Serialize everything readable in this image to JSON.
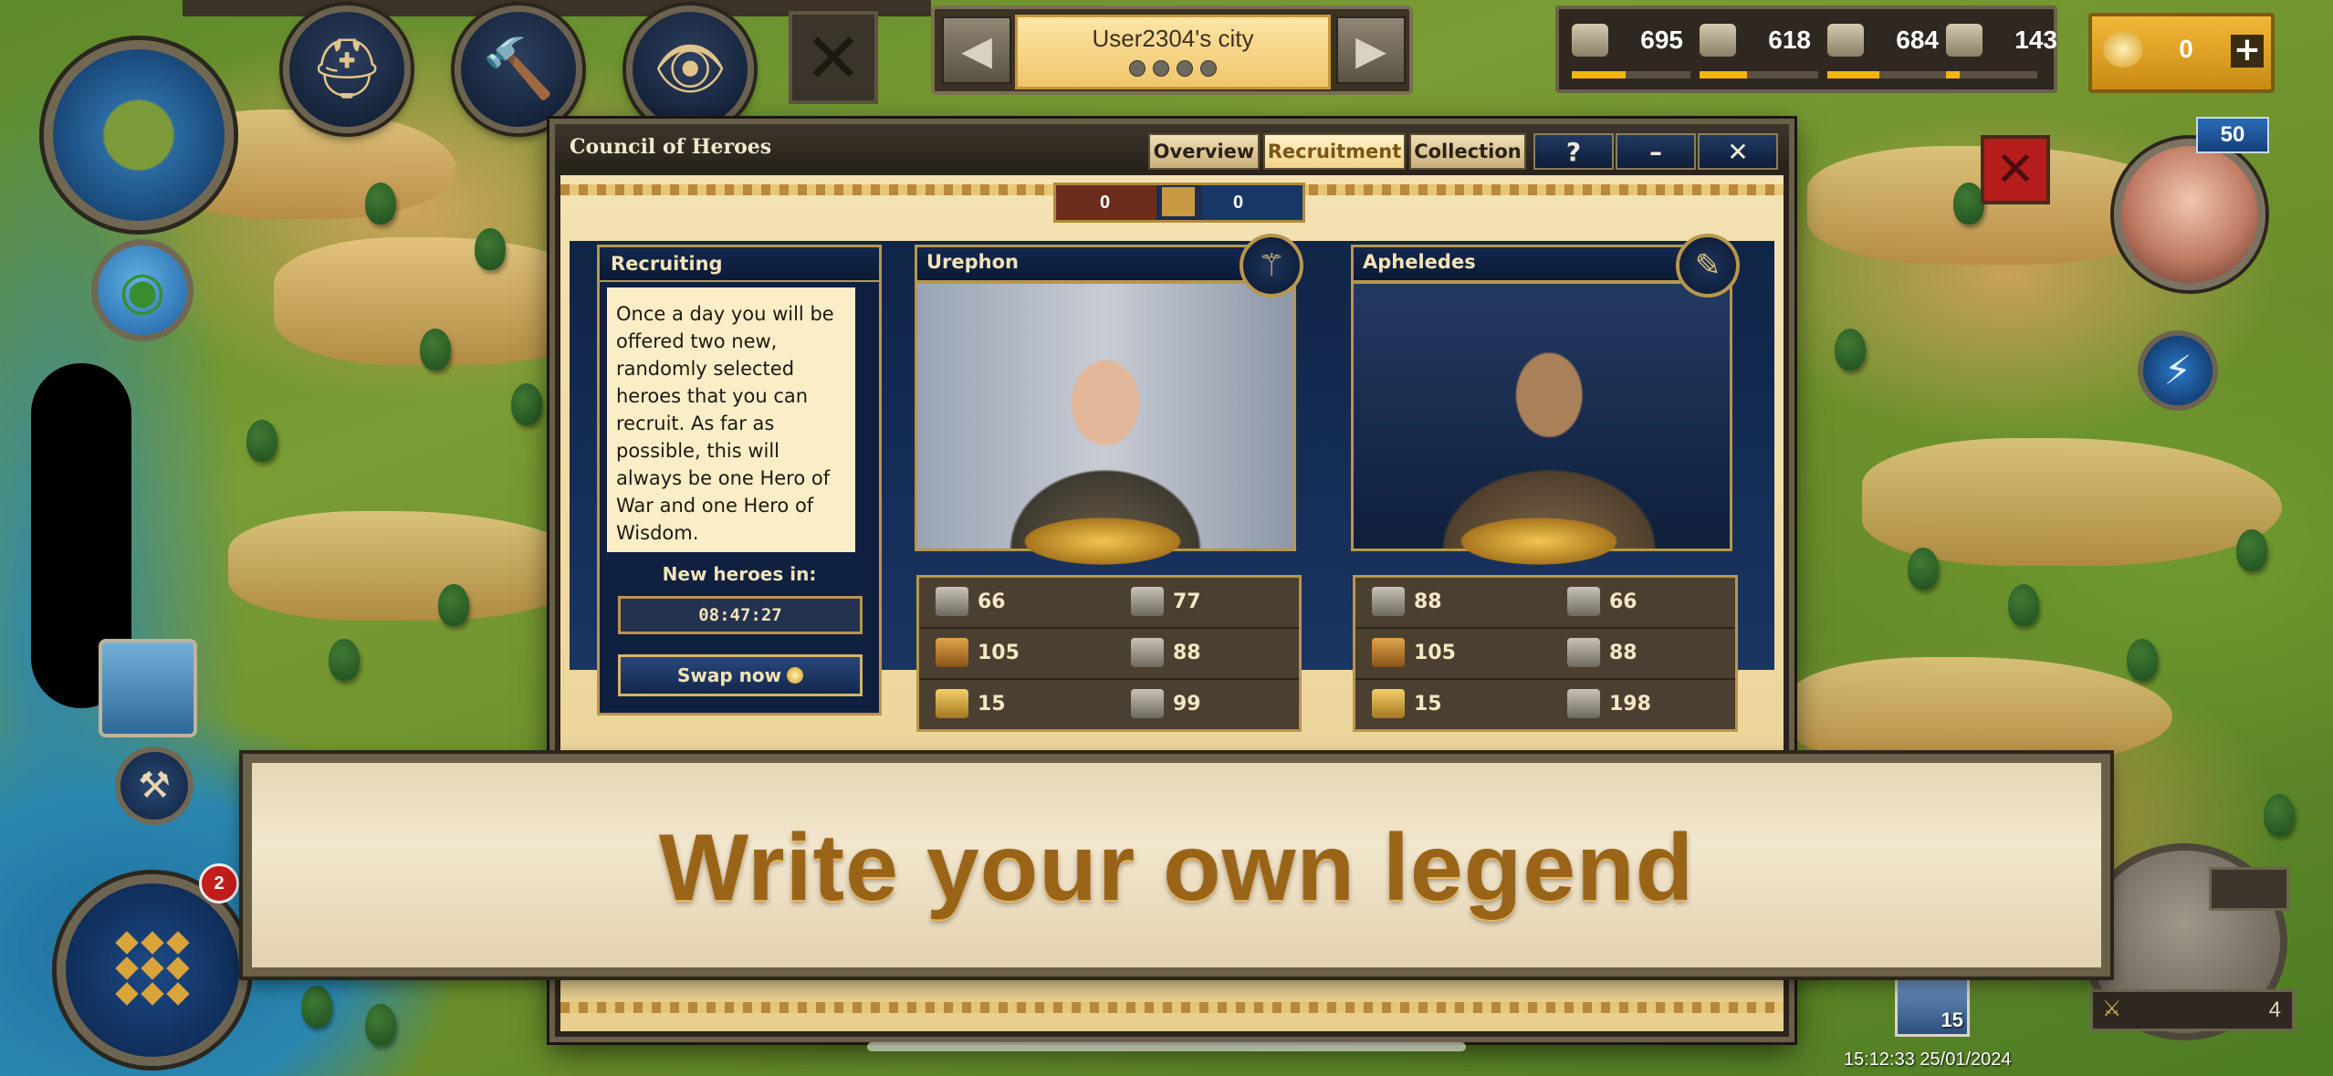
{
  "city": {
    "name": "User2304's city"
  },
  "resources": {
    "wood": "695",
    "stone": "618",
    "silver": "684",
    "population": "143",
    "gold": "0"
  },
  "player": {
    "level": "50"
  },
  "dialog": {
    "title": "Council of Heroes",
    "tabs": [
      {
        "label": "Overview"
      },
      {
        "label": "Recruitment"
      },
      {
        "label": "Collection"
      }
    ],
    "controls": {
      "help": "?",
      "minimize": "–",
      "close": "✕"
    },
    "hero_counts": {
      "war": "0",
      "wisdom": "0"
    },
    "recruiting": {
      "heading": "Recruiting",
      "description": "Once a day you will be offered two new, randomly selected heroes that you can recruit. As far as possible, this will always be one Hero of War and one Hero of Wisdom.",
      "new_heroes_label": "New heroes in:",
      "timer": "08:47:27",
      "swap_label": "Swap now"
    },
    "heroes": [
      {
        "name": "Urephon",
        "stats": [
          "66",
          "77",
          "105",
          "88",
          "15",
          "99"
        ]
      },
      {
        "name": "Apheledes",
        "stats": [
          "88",
          "66",
          "105",
          "88",
          "15",
          "198"
        ]
      }
    ]
  },
  "banner": {
    "text": "Write your own legend"
  },
  "notifications": {
    "menu_badge": "2"
  },
  "units": {
    "count": "15"
  },
  "counter": {
    "value": "4"
  },
  "clock": "15:12:33 25/01/2024",
  "icons": {
    "island": "island-map-icon",
    "helmet": "helmet-icon",
    "hammer": "hammer-icon",
    "eye": "eye-icon",
    "globe": "globe-icon",
    "bolt": "lightning-icon",
    "menu": "menu-grid-icon"
  },
  "colors": {
    "accent_gold": "#f1b511",
    "banner_text": "#9a6418",
    "alert_red": "#b51c1c"
  }
}
